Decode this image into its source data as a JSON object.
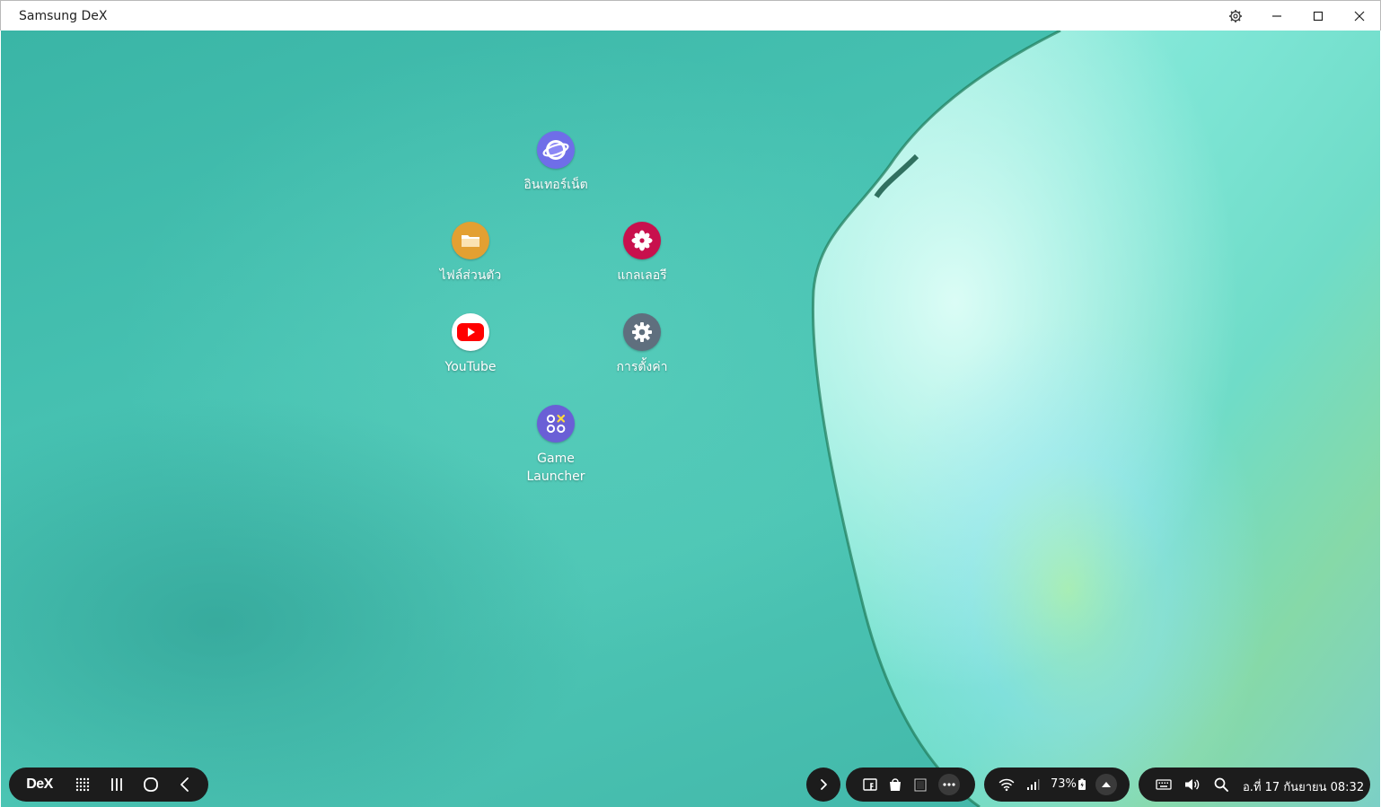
{
  "window": {
    "title": "Samsung DeX",
    "buttons": [
      "settings-icon",
      "minimize-icon",
      "maximize-icon",
      "close-icon"
    ]
  },
  "desktop": {
    "apps": [
      {
        "label": "อินเทอร์เน็ต",
        "icon": "samsung-internet-icon",
        "color": "#6f6ee8"
      },
      {
        "label": "ไฟล์ส่วนตัว",
        "icon": "my-files-icon",
        "color": "#e3a032"
      },
      {
        "label": "แกลเลอรี",
        "icon": "gallery-icon",
        "color": "#c8104d"
      },
      {
        "label": "YouTube",
        "icon": "youtube-icon",
        "color": "#ff0000"
      },
      {
        "label": "การตั้งค่า",
        "icon": "settings-icon",
        "color": "#5f6f7e"
      },
      {
        "label_line1": "Game",
        "label_line2": "Launcher",
        "icon": "game-launcher-icon",
        "color": "#6a5fd6"
      }
    ]
  },
  "taskbar": {
    "dex_label": "DeX",
    "nav_icons": [
      "apps-grid-icon",
      "recents-icon",
      "home-icon",
      "back-icon"
    ],
    "pinned_icons": [
      "expand-arrow-icon",
      "facebook-icon",
      "store-bag-icon",
      "phone-app-icon",
      "more-icon"
    ],
    "status": {
      "battery": "73%",
      "icons": [
        "wifi-icon",
        "signal-icon",
        "battery-icon",
        "notification-panel-icon"
      ]
    },
    "system_icons": [
      "keyboard-icon",
      "volume-icon",
      "search-icon"
    ],
    "clock": "อ.ที่ 17 กันยายน 08:32"
  }
}
